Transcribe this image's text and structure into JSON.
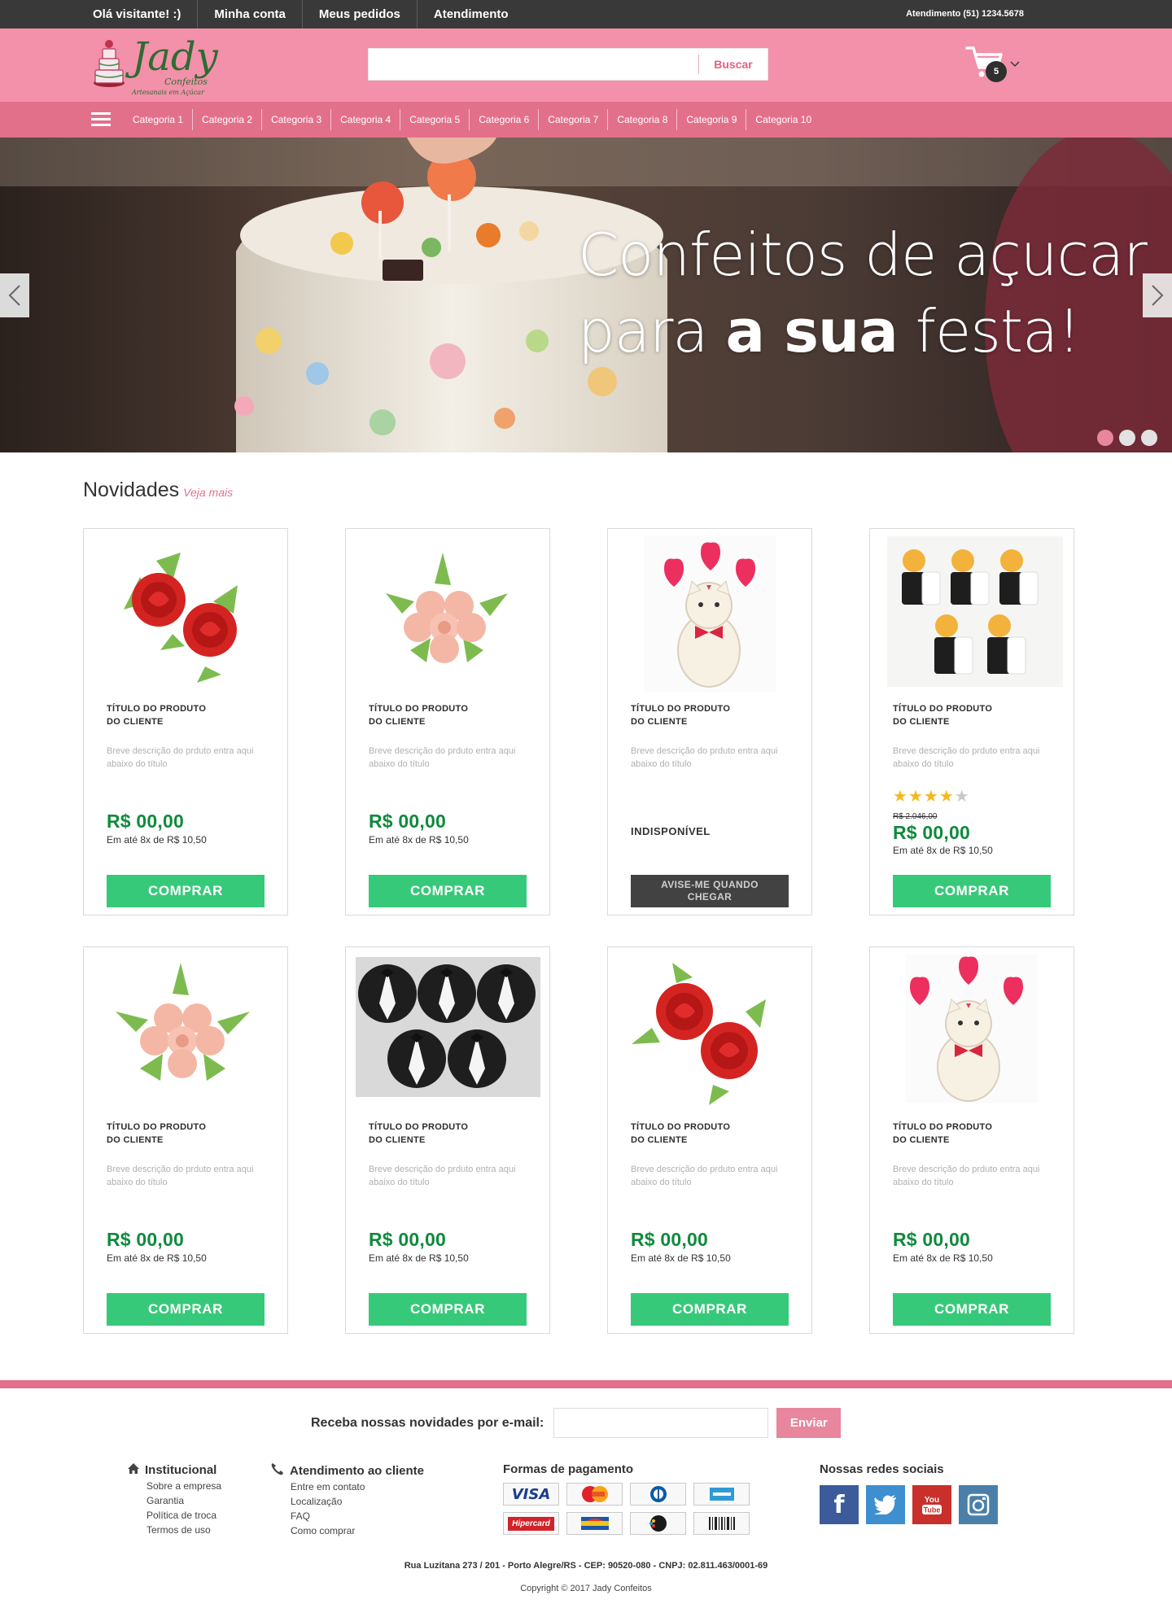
{
  "topbar": {
    "greeting": "Olá visitante! :)",
    "links": [
      "Minha conta",
      "Meus pedidos",
      "Atendimento"
    ],
    "phone": "Atendimento (51) 1234.5678"
  },
  "header": {
    "logo_name": "Jady",
    "logo_sub1": "Confeitos",
    "logo_sub2": "Artesanais em Açúcar",
    "search_placeholder": "",
    "search_button": "Buscar",
    "cart_count": "5"
  },
  "categories": [
    "Categoria 1",
    "Categoria 2",
    "Categoria 3",
    "Categoria 4",
    "Categoria 5",
    "Categoria 6",
    "Categoria 7",
    "Categoria 8",
    "Categoria 9",
    "Categoria 10"
  ],
  "hero": {
    "line1": "Confeitos de açucar",
    "line2_pre": "para ",
    "line2_bold": "a sua",
    "line2_post": " festa!",
    "slides": 3,
    "active_slide": 1
  },
  "section": {
    "title": "Novidades",
    "more": "Veja mais"
  },
  "products": [
    {
      "image": "red-roses",
      "title1": "TÍTULO DO PRODUTO",
      "title2": "DO CLIENTE",
      "desc": "Breve descrição do prduto entra aqui abaixo do título",
      "price": "R$ 00,00",
      "installments": "Em até 8x de R$ 10,50",
      "button": "COMPRAR"
    },
    {
      "image": "peach-roses",
      "title1": "TÍTULO DO PRODUTO",
      "title2": "DO CLIENTE",
      "desc": "Breve descrição do prduto entra aqui abaixo do título",
      "price": "R$ 00,00",
      "installments": "Em até 8x de R$ 10,50",
      "button": "COMPRAR"
    },
    {
      "image": "cat-hearts",
      "title1": "TÍTULO DO PRODUTO",
      "title2": "DO CLIENTE",
      "desc": "Breve descrição do prduto entra aqui abaixo do título",
      "status": "INDISPONÍVEL",
      "notify1": "AVISE-ME QUANDO",
      "notify2": "CHEGAR"
    },
    {
      "image": "bride-groom",
      "title1": "TÍTULO DO PRODUTO",
      "title2": "DO CLIENTE",
      "desc": "Breve descrição do prduto entra aqui abaixo do título",
      "rating": 4,
      "old_price": "R$  2.046,00",
      "price": "R$ 00,00",
      "installments": "Em até 8x de R$ 10,50",
      "button": "COMPRAR"
    },
    {
      "image": "peach-roses",
      "title1": "TÍTULO DO PRODUTO",
      "title2": "DO CLIENTE",
      "desc": "Breve descrição do prduto entra aqui abaixo do título",
      "price": "R$ 00,00",
      "installments": "Em até 8x de R$ 10,50",
      "button": "COMPRAR"
    },
    {
      "image": "tuxedos",
      "title1": "TÍTULO DO PRODUTO",
      "title2": "DO CLIENTE",
      "desc": "Breve descrição do prduto entra aqui abaixo do título",
      "price": "R$ 00,00",
      "installments": "Em até 8x de R$ 10,50",
      "button": "COMPRAR"
    },
    {
      "image": "red-roses",
      "title1": "TÍTULO DO PRODUTO",
      "title2": "DO CLIENTE",
      "desc": "Breve descrição do prduto entra aqui abaixo do título",
      "price": "R$ 00,00",
      "installments": "Em até 8x de R$ 10,50",
      "button": "COMPRAR"
    },
    {
      "image": "cat-hearts",
      "title1": "TÍTULO DO PRODUTO",
      "title2": "DO CLIENTE",
      "desc": "Breve descrição do prduto entra aqui abaixo do título",
      "price": "R$ 00,00",
      "installments": "Em até 8x de R$ 10,50",
      "button": "COMPRAR"
    }
  ],
  "footer": {
    "newsletter_label": "Receba nossas novidades por e-mail:",
    "newsletter_button": "Enviar",
    "institucional": {
      "title": "Institucional",
      "items": [
        "Sobre a empresa",
        "Garantia",
        "Política de troca",
        "Termos de uso"
      ]
    },
    "atendimento": {
      "title": "Atendimento ao cliente",
      "items": [
        "Entre em contato",
        "Localização",
        "FAQ",
        "Como comprar"
      ]
    },
    "pagamento": {
      "title": "Formas de pagamento",
      "methods": [
        "VISA",
        "MasterCard",
        "Diners",
        "Amex",
        "Hipercard",
        "Aura",
        "elo",
        "Boleto"
      ]
    },
    "redes": {
      "title": "Nossas redes sociais",
      "items": [
        "facebook",
        "twitter",
        "youtube",
        "instagram"
      ]
    },
    "address": "Rua Luzitana 273 / 201 - Porto Alegre/RS - CEP: 90520-080 - CNPJ: 02.811.463/0001-69",
    "copyright": "Copyright © 2017 Jady Confeitos"
  },
  "colors": {
    "topbar": "#393939",
    "header_pink": "#f390aa",
    "nav_pink": "#e3708b",
    "buy_green": "#37c97a",
    "price_green": "#108a3d"
  }
}
